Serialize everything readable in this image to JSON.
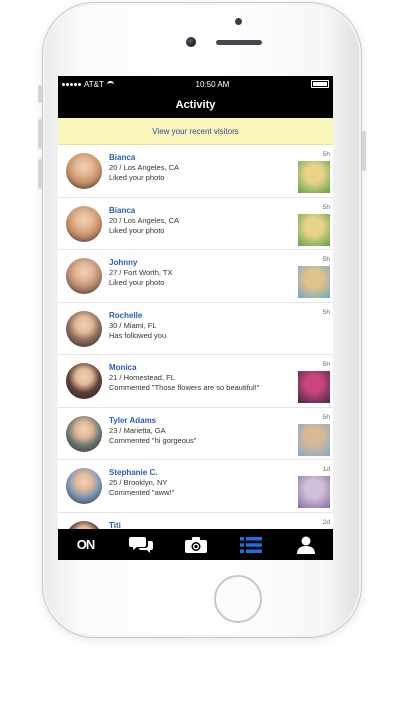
{
  "status_bar": {
    "carrier": "AT&T",
    "time": "10:50 AM"
  },
  "nav": {
    "title": "Activity"
  },
  "banner": {
    "text": "View your recent visitors"
  },
  "activity": [
    {
      "name": "Bianca",
      "info": "20 / Los Angeles, CA",
      "action": "Liked your photo",
      "time": "5h",
      "avatar_color": "#c9906a",
      "has_photo": true
    },
    {
      "name": "Bianca",
      "info": "20 / Los Angeles, CA",
      "action": "Liked your photo",
      "time": "5h",
      "avatar_color": "#c9906a",
      "has_photo": true
    },
    {
      "name": "Johnny",
      "info": "27 / Fort Worth, TX",
      "action": "Liked your photo",
      "time": "5h",
      "avatar_color": "#b78b73",
      "has_photo": true
    },
    {
      "name": "Rochelle",
      "info": "30 / Miami, FL",
      "action": "Has followed you",
      "time": "5h",
      "avatar_color": "#8a6a5a",
      "has_photo": false
    },
    {
      "name": "Monica",
      "info": "21 / Homestead, FL",
      "action": "Commented \"Those flowers are so beautiful!\"",
      "time": "5h",
      "avatar_color": "#5a3e36",
      "has_photo": true
    },
    {
      "name": "Tyler Adams",
      "info": "23 / Marietta, GA",
      "action": "Commented \"hi gorgeous\"",
      "time": "5h",
      "avatar_color": "#6c7a72",
      "has_photo": true
    },
    {
      "name": "Stephanie C.",
      "info": "25 / Brooklyn, NY",
      "action": "Commented \"aww!\"",
      "time": "1d",
      "avatar_color": "#7896b8",
      "has_photo": true
    },
    {
      "name": "Titi",
      "info": "",
      "action": "",
      "time": "2d",
      "avatar_color": "#4a3a36",
      "has_photo": false
    }
  ],
  "tab_bar": {
    "logo": "ON",
    "tabs": [
      {
        "icon": "on-logo-icon",
        "active": false
      },
      {
        "icon": "chat-bubbles-icon",
        "active": false
      },
      {
        "icon": "camera-icon",
        "active": false
      },
      {
        "icon": "list-icon",
        "active": true
      },
      {
        "icon": "profile-icon",
        "active": false
      }
    ]
  },
  "colors": {
    "accent": "#1e6fe0",
    "banner_bg": "#faf5b9",
    "name_link": "#2a5cb8"
  }
}
